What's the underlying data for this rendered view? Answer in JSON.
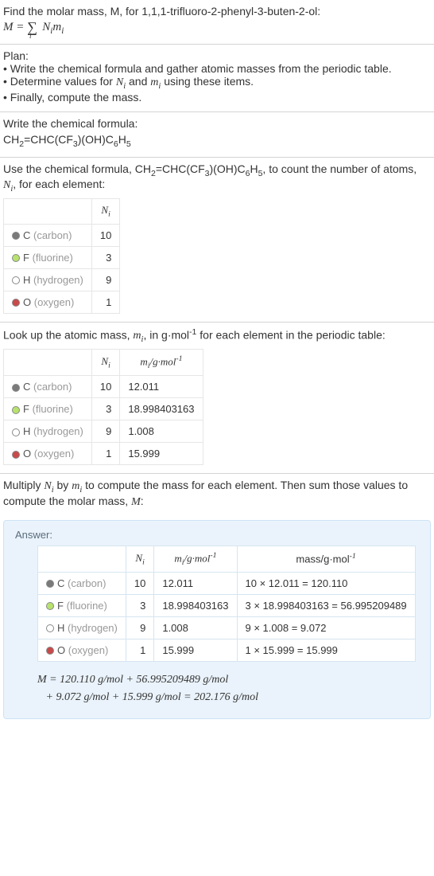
{
  "s1": {
    "line1": "Find the molar mass, M, for 1,1,1-trifluoro-2-phenyl-3-buten-2-ol:"
  },
  "s2": {
    "title": "Plan:",
    "b1": "• Write the chemical formula and gather atomic masses from the periodic table.",
    "b2_a": "• Determine values for ",
    "b2_b": " and ",
    "b2_c": " using these items.",
    "b3": "• Finally, compute the mass."
  },
  "s3": {
    "title": "Write the chemical formula:"
  },
  "s4": {
    "text_a": "Use the chemical formula, ",
    "text_b": ", to count the number of atoms, ",
    "text_c": ", for each element:",
    "header_ni": "N",
    "rows": [
      {
        "color": "#7a7a7a",
        "sym": "C",
        "name": " (carbon)",
        "n": "10"
      },
      {
        "color": "#b7e26e",
        "sym": "F",
        "name": " (fluorine)",
        "n": "3"
      },
      {
        "color": "#ffffff",
        "sym": "H",
        "name": " (hydrogen)",
        "n": "9"
      },
      {
        "color": "#c94a4a",
        "sym": "O",
        "name": " (oxygen)",
        "n": "1"
      }
    ]
  },
  "s5": {
    "text_a": "Look up the atomic mass, ",
    "text_b": ", in g·mol",
    "text_c": " for each element in the periodic table:",
    "header_ni": "N",
    "header_mi": "m",
    "header_unit": "/g·mol",
    "rows": [
      {
        "color": "#7a7a7a",
        "sym": "C",
        "name": " (carbon)",
        "n": "10",
        "m": "12.011"
      },
      {
        "color": "#b7e26e",
        "sym": "F",
        "name": " (fluorine)",
        "n": "3",
        "m": "18.998403163"
      },
      {
        "color": "#ffffff",
        "sym": "H",
        "name": " (hydrogen)",
        "n": "9",
        "m": "1.008"
      },
      {
        "color": "#c94a4a",
        "sym": "O",
        "name": " (oxygen)",
        "n": "1",
        "m": "15.999"
      }
    ]
  },
  "s6": {
    "text_a": "Multiply ",
    "text_b": " by ",
    "text_c": " to compute the mass for each element. Then sum those values to compute the molar mass, ",
    "text_d": ":"
  },
  "answer": {
    "title": "Answer:",
    "header_ni": "N",
    "header_mi": "m",
    "header_unit": "/g·mol",
    "header_mass": "mass/g·mol",
    "rows": [
      {
        "color": "#7a7a7a",
        "sym": "C",
        "name": " (carbon)",
        "n": "10",
        "m": "12.011",
        "calc": "10 × 12.011 = 120.110"
      },
      {
        "color": "#b7e26e",
        "sym": "F",
        "name": " (fluorine)",
        "n": "3",
        "m": "18.998403163",
        "calc": "3 × 18.998403163 = 56.995209489"
      },
      {
        "color": "#ffffff",
        "sym": "H",
        "name": " (hydrogen)",
        "n": "9",
        "m": "1.008",
        "calc": "9 × 1.008 = 9.072"
      },
      {
        "color": "#c94a4a",
        "sym": "O",
        "name": " (oxygen)",
        "n": "1",
        "m": "15.999",
        "calc": "1 × 15.999 = 15.999"
      }
    ],
    "result1": "M = 120.110 g/mol + 56.995209489 g/mol",
    "result2": "+ 9.072 g/mol + 15.999 g/mol = 202.176 g/mol"
  },
  "chart_data": {
    "type": "table",
    "molecule": "1,1,1-trifluoro-2-phenyl-3-buten-2-ol",
    "formula": "CH2=CHC(CF3)(OH)C6H5",
    "elements": [
      {
        "element": "C",
        "name": "carbon",
        "N_i": 10,
        "m_i": 12.011,
        "mass": 120.11
      },
      {
        "element": "F",
        "name": "fluorine",
        "N_i": 3,
        "m_i": 18.998403163,
        "mass": 56.995209489
      },
      {
        "element": "H",
        "name": "hydrogen",
        "N_i": 9,
        "m_i": 1.008,
        "mass": 9.072
      },
      {
        "element": "O",
        "name": "oxygen",
        "N_i": 1,
        "m_i": 15.999,
        "mass": 15.999
      }
    ],
    "molar_mass_g_per_mol": 202.176
  }
}
